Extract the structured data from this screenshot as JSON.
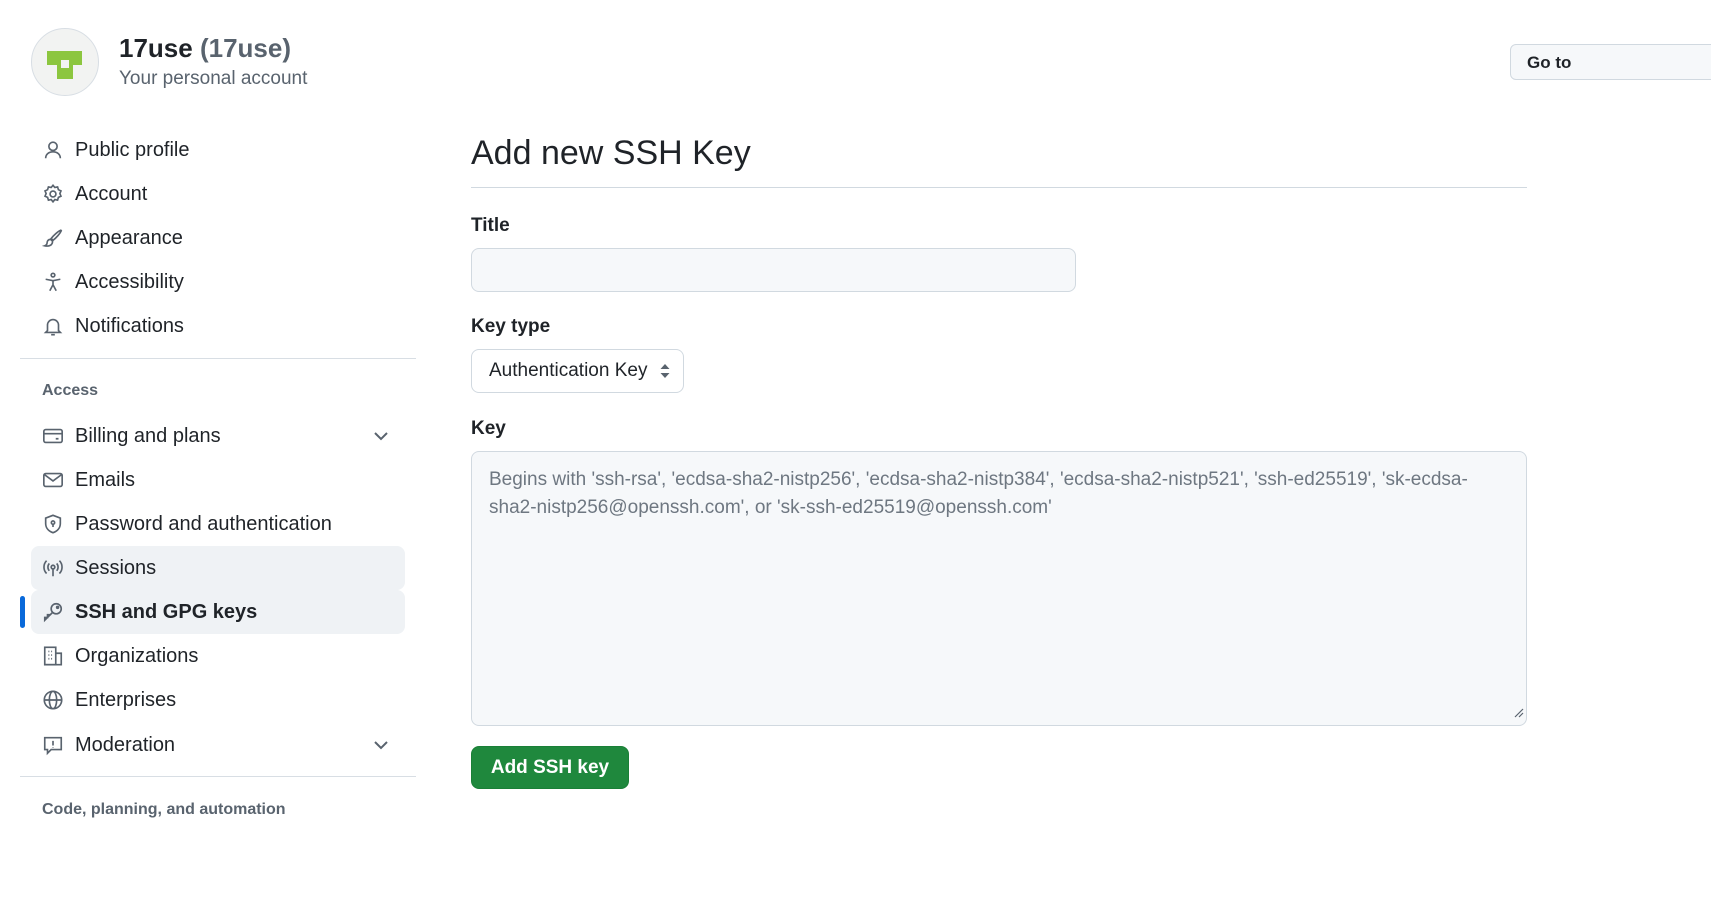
{
  "account": {
    "name": "17use",
    "login": "(17use)",
    "subtitle": "Your personal account",
    "goto_button": "Go to"
  },
  "sidebar": {
    "items": [
      {
        "label": "Public profile",
        "icon": "person-icon"
      },
      {
        "label": "Account",
        "icon": "gear-icon"
      },
      {
        "label": "Appearance",
        "icon": "paintbrush-icon"
      },
      {
        "label": "Accessibility",
        "icon": "accessibility-icon"
      },
      {
        "label": "Notifications",
        "icon": "bell-icon"
      }
    ],
    "access_title": "Access",
    "access_items": [
      {
        "label": "Billing and plans",
        "icon": "credit-card-icon",
        "expandable": true
      },
      {
        "label": "Emails",
        "icon": "mail-icon"
      },
      {
        "label": "Password and authentication",
        "icon": "shield-lock-icon"
      },
      {
        "label": "Sessions",
        "icon": "broadcast-icon",
        "state": "hover"
      },
      {
        "label": "SSH and GPG keys",
        "icon": "key-icon",
        "state": "active"
      },
      {
        "label": "Organizations",
        "icon": "organization-icon"
      },
      {
        "label": "Enterprises",
        "icon": "globe-icon"
      },
      {
        "label": "Moderation",
        "icon": "report-icon",
        "expandable": true
      }
    ],
    "code_title": "Code, planning, and automation"
  },
  "main": {
    "title": "Add new SSH Key",
    "title_field": {
      "label": "Title",
      "value": "",
      "placeholder": ""
    },
    "key_type": {
      "label": "Key type",
      "selected": "Authentication Key"
    },
    "key_field": {
      "label": "Key",
      "placeholder": "Begins with 'ssh-rsa', 'ecdsa-sha2-nistp256', 'ecdsa-sha2-nistp384', 'ecdsa-sha2-nistp521', 'ssh-ed25519', 'sk-ecdsa-sha2-nistp256@openssh.com', or 'sk-ssh-ed25519@openssh.com'"
    },
    "submit_label": "Add SSH key"
  },
  "colors": {
    "accent": "#0969da",
    "primary_button": "#1f883d",
    "avatar_green": "#8cc63f"
  }
}
